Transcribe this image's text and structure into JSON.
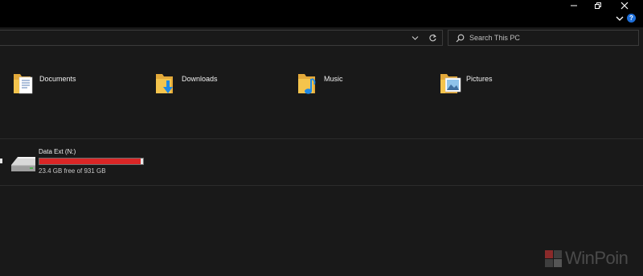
{
  "window": {
    "controls": [
      "minimize",
      "restore",
      "close"
    ]
  },
  "ribbon": {
    "expand_icon": "chevron-down-icon",
    "help_label": "?"
  },
  "search": {
    "placeholder": "Search This PC",
    "icon": "search-icon"
  },
  "folders": [
    {
      "label": "Documents",
      "icon": "documents-folder-icon"
    },
    {
      "label": "Downloads",
      "icon": "downloads-folder-icon"
    },
    {
      "label": "Music",
      "icon": "music-folder-icon"
    },
    {
      "label": "Pictures",
      "icon": "pictures-folder-icon"
    }
  ],
  "drives": [
    {
      "label": "Data Ext (N:)",
      "free_text": "23.4 GB free of 931 GB",
      "used_fraction": 0.975,
      "icon": "hard-drive-icon"
    }
  ],
  "watermark": {
    "text": "WinPoin"
  },
  "colors": {
    "background": "#191919",
    "titlebar": "#000000",
    "help_badge": "#1e6fd9",
    "drive_bar_fill": "#da2626",
    "folder_yellow": "#f4c44d"
  }
}
